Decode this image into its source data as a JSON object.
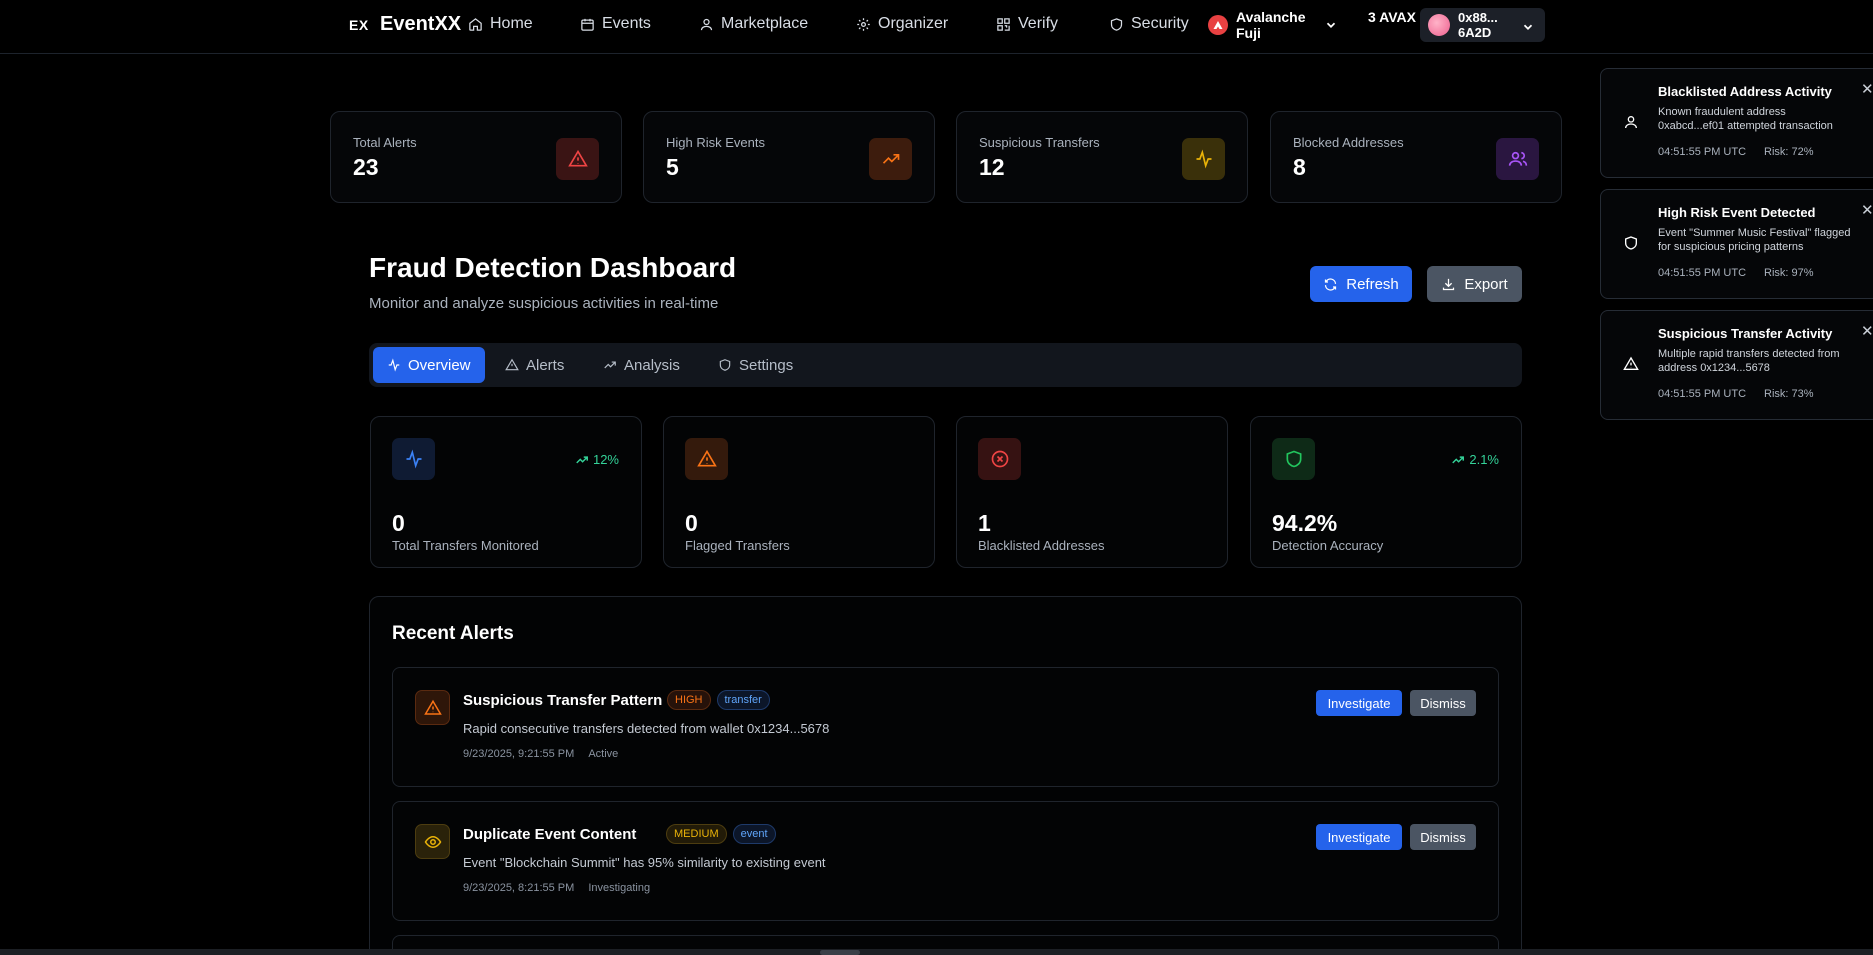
{
  "nav": {
    "logo_mark": "EX",
    "logo_text": "EventXX",
    "items": [
      {
        "label": "Home",
        "icon": "home-icon"
      },
      {
        "label": "Events",
        "icon": "calendar-icon"
      },
      {
        "label": "Marketplace",
        "icon": "user-icon"
      },
      {
        "label": "Organizer",
        "icon": "gear-icon"
      },
      {
        "label": "Verify",
        "icon": "qr-icon"
      },
      {
        "label": "Security",
        "icon": "shield-icon"
      }
    ],
    "network": "Avalanche Fuji",
    "balance": "3 AVAX",
    "wallet": "0x88... 6A2D"
  },
  "top_stats": [
    {
      "label": "Total Alerts",
      "value": "23",
      "icon": "alert-triangle-icon",
      "color": "#ef4444"
    },
    {
      "label": "High Risk Events",
      "value": "5",
      "icon": "trending-up-icon",
      "color": "#f97316"
    },
    {
      "label": "Suspicious Transfers",
      "value": "12",
      "icon": "activity-icon",
      "color": "#eab308"
    },
    {
      "label": "Blocked Addresses",
      "value": "8",
      "icon": "users-icon",
      "color": "#a855f7"
    }
  ],
  "header": {
    "title": "Fraud Detection Dashboard",
    "subtitle": "Monitor and analyze suspicious activities in real-time",
    "refresh_label": "Refresh",
    "export_label": "Export"
  },
  "tabs": [
    {
      "label": "Overview",
      "active": true
    },
    {
      "label": "Alerts",
      "active": false
    },
    {
      "label": "Analysis",
      "active": false
    },
    {
      "label": "Settings",
      "active": false
    }
  ],
  "metrics": [
    {
      "value": "0",
      "label": "Total Transfers Monitored",
      "trend": "12%",
      "icon": "activity-icon",
      "color": "#3b82f6"
    },
    {
      "value": "0",
      "label": "Flagged Transfers",
      "trend": "",
      "icon": "alert-triangle-icon",
      "color": "#f97316"
    },
    {
      "value": "1",
      "label": "Blacklisted Addresses",
      "trend": "",
      "icon": "x-circle-icon",
      "color": "#ef4444"
    },
    {
      "value": "94.2%",
      "label": "Detection Accuracy",
      "trend": "2.1%",
      "icon": "shield-check-icon",
      "color": "#22c55e"
    }
  ],
  "recent_alerts": {
    "title": "Recent Alerts",
    "investigate_label": "Investigate",
    "dismiss_label": "Dismiss",
    "items": [
      {
        "title": "Suspicious Transfer Pattern",
        "severity": "HIGH",
        "type": "transfer",
        "description": "Rapid consecutive transfers detected from wallet 0x1234...5678",
        "time": "9/23/2025, 9:21:55 PM",
        "status": "Active",
        "icon": "alert-triangle-icon"
      },
      {
        "title": "Duplicate Event Content",
        "severity": "MEDIUM",
        "type": "event",
        "description": "Event \"Blockchain Summit\" has 95% similarity to existing event",
        "time": "9/23/2025, 8:21:55 PM",
        "status": "Investigating",
        "icon": "eye-icon"
      }
    ]
  },
  "toasts": [
    {
      "title": "Blacklisted Address Activity",
      "message": "Known fraudulent address 0xabcd...ef01 attempted transaction",
      "time": "04:51:55 PM UTC",
      "risk": "Risk: 72%",
      "icon": "user-icon"
    },
    {
      "title": "High Risk Event Detected",
      "message": "Event \"Summer Music Festival\" flagged for suspicious pricing patterns",
      "time": "04:51:55 PM UTC",
      "risk": "Risk: 97%",
      "icon": "shield-icon"
    },
    {
      "title": "Suspicious Transfer Activity",
      "message": "Multiple rapid transfers detected from address 0x1234...5678",
      "time": "04:51:55 PM UTC",
      "risk": "Risk: 73%",
      "icon": "alert-triangle-icon"
    }
  ],
  "colors": {
    "accent": "#2563eb",
    "muted_button": "#4b5563",
    "success": "#34d399"
  }
}
